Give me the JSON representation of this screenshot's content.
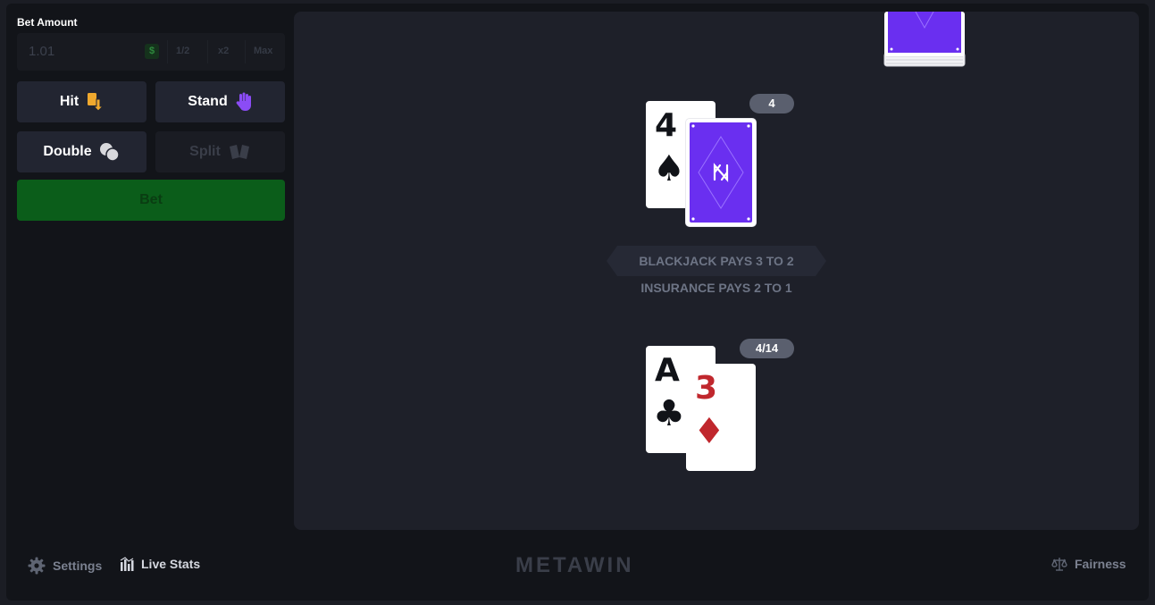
{
  "bet": {
    "label": "Bet Amount",
    "value": "1.01",
    "currency": "$",
    "half_label": "1/2",
    "double_label": "x2",
    "max_label": "Max"
  },
  "actions": {
    "hit": "Hit",
    "stand": "Stand",
    "double": "Double",
    "split": "Split",
    "bet": "Bet"
  },
  "table": {
    "dealer": {
      "score": "4",
      "cards": [
        {
          "rank": "4",
          "suit": "♠",
          "color": "black"
        },
        {
          "face_down": true
        }
      ]
    },
    "player": {
      "score": "4/14",
      "cards": [
        {
          "rank": "A",
          "suit": "♣",
          "color": "black"
        },
        {
          "rank": "3",
          "suit": "♦",
          "color": "red"
        }
      ]
    },
    "rule_blackjack": "BLACKJACK PAYS 3 TO 2",
    "rule_insurance": "INSURANCE PAYS 2 TO 1"
  },
  "footer": {
    "settings": "Settings",
    "live_stats": "Live Stats",
    "logo": "METAWIN",
    "fairness": "Fairness"
  },
  "colors": {
    "card_back": "#6a2ff0",
    "bet_button": "#0b5d1a",
    "suit_red": "#c0272d"
  },
  "icons": {
    "hit": "card-down-arrow-icon",
    "stand": "hand-icon",
    "double": "chips-icon",
    "split": "split-cards-icon",
    "settings": "gear-icon",
    "live_stats": "bar-chart-icon",
    "fairness": "scales-icon"
  }
}
